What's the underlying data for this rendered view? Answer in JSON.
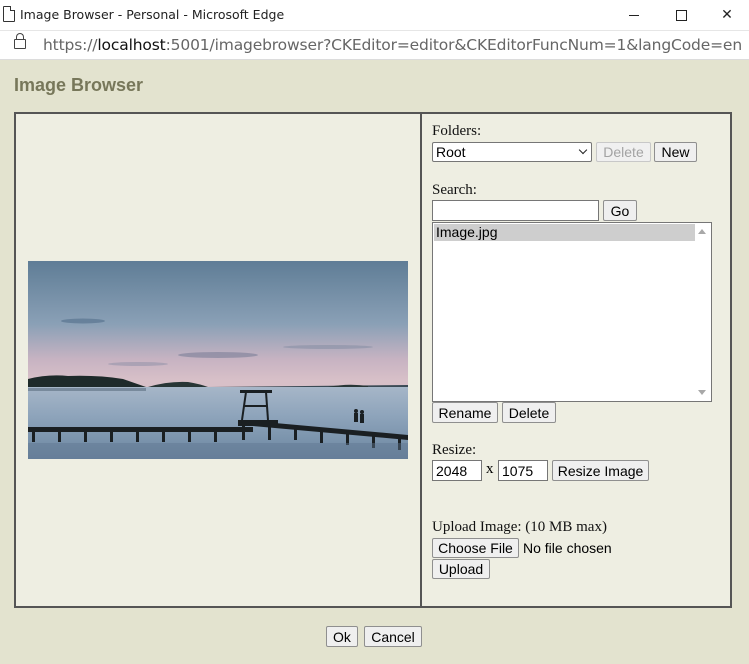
{
  "window": {
    "title": "Image Browser - Personal - Microsoft Edge",
    "url_prefix": "https://",
    "url_host": "localhost",
    "url_rest": ":5001/imagebrowser?CKEditor=editor&CKEditorFuncNum=1&langCode=en"
  },
  "page": {
    "heading": "Image Browser"
  },
  "folders": {
    "label": "Folders:",
    "selected": "Root",
    "delete_label": "Delete",
    "new_label": "New"
  },
  "search": {
    "label": "Search:",
    "value": "",
    "go_label": "Go"
  },
  "files": {
    "items": [
      "Image.jpg"
    ],
    "selected_index": 0
  },
  "file_actions": {
    "rename_label": "Rename",
    "delete_label": "Delete"
  },
  "resize": {
    "label": "Resize:",
    "width": "2048",
    "separator": "x",
    "height": "1075",
    "button_label": "Resize Image"
  },
  "upload": {
    "label": "Upload Image: (10 MB max)",
    "choose_label": "Choose File",
    "no_file_text": "No file chosen",
    "upload_label": "Upload"
  },
  "footer": {
    "ok_label": "Ok",
    "cancel_label": "Cancel"
  },
  "colors": {
    "page_bg": "#e3e3cf",
    "panel_bg": "#eeeee2",
    "heading": "#77775a",
    "border": "#555555"
  }
}
